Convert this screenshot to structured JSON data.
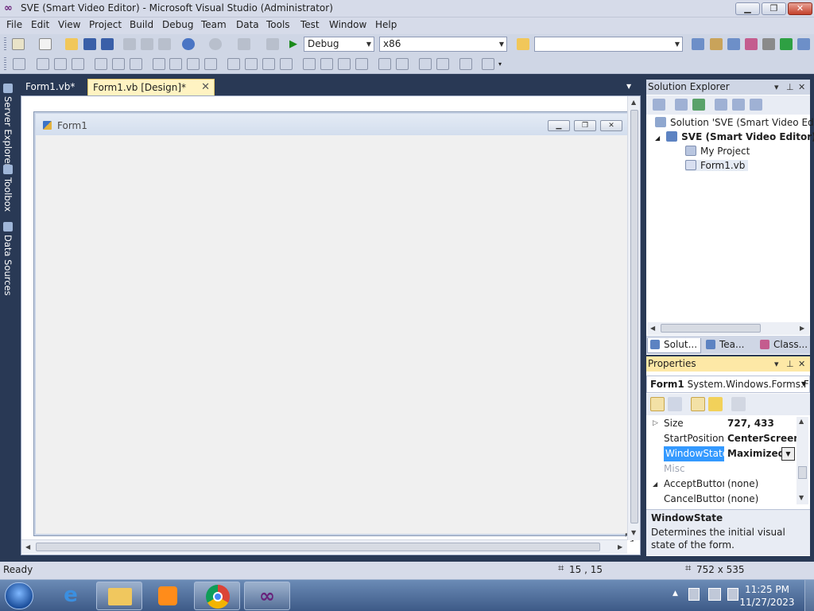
{
  "window": {
    "title": "SVE (Smart Video Editor) - Microsoft Visual Studio (Administrator)",
    "controls": {
      "minimize": "▁",
      "maximize": "❐",
      "close": "✕"
    }
  },
  "menu": [
    "File",
    "Edit",
    "View",
    "Project",
    "Build",
    "Debug",
    "Team",
    "Data",
    "Tools",
    "Test",
    "Window",
    "Help"
  ],
  "toolbar": {
    "config_value": "Debug",
    "platform_value": "x86",
    "find_value": ""
  },
  "left_dock": [
    "Server Explorer",
    "Toolbox",
    "Data Sources"
  ],
  "doc_tabs": [
    {
      "label": "Form1.vb*",
      "active": false
    },
    {
      "label": "Form1.vb [Design]*",
      "active": true
    }
  ],
  "form": {
    "title": "Form1",
    "buttons": {
      "minimize": "▁",
      "maximize": "❐",
      "close": "✕"
    }
  },
  "solution_explorer": {
    "title": "Solution Explorer",
    "tree": [
      {
        "label": "Solution 'SVE (Smart Video Editor)",
        "level": 0,
        "bold": false
      },
      {
        "label": "SVE (Smart Video Editor)",
        "level": 1,
        "bold": true,
        "expanded": true
      },
      {
        "label": "My Project",
        "level": 2,
        "bold": false
      },
      {
        "label": "Form1.vb",
        "level": 2,
        "bold": false,
        "selected": true
      }
    ],
    "tabs": [
      "Solut...",
      "Tea...",
      "Class..."
    ]
  },
  "properties": {
    "title": "Properties",
    "object_name": "Form1",
    "object_type": "System.Windows.Forms.Fo",
    "rows": [
      {
        "name": "Size",
        "value": "727, 433",
        "expandable": true
      },
      {
        "name": "StartPosition",
        "value": "CenterScreen"
      },
      {
        "name": "WindowState",
        "value": "Maximized",
        "selected": true
      },
      {
        "name": "Misc",
        "value": "",
        "category": true
      },
      {
        "name": "AcceptButton",
        "value": "(none)"
      },
      {
        "name": "CancelButton",
        "value": "(none)"
      }
    ],
    "description_title": "WindowState",
    "description_text": "Determines the initial visual state of the form."
  },
  "status": {
    "text": "Ready",
    "position": "15 , 15",
    "size": "752 x 535"
  },
  "taskbar": {
    "apps": [
      "start-button",
      "internet-explorer",
      "windows-explorer",
      "media-player",
      "chrome",
      "visual-studio"
    ],
    "time": "11:25 PM",
    "date": "11/27/2023"
  },
  "colors": {
    "ide_dark": "#293955",
    "chrome": "#d6dbe9",
    "active_tab": "#fff3c2",
    "selection": "#3399ff",
    "taskbar": "#3d5a87"
  }
}
